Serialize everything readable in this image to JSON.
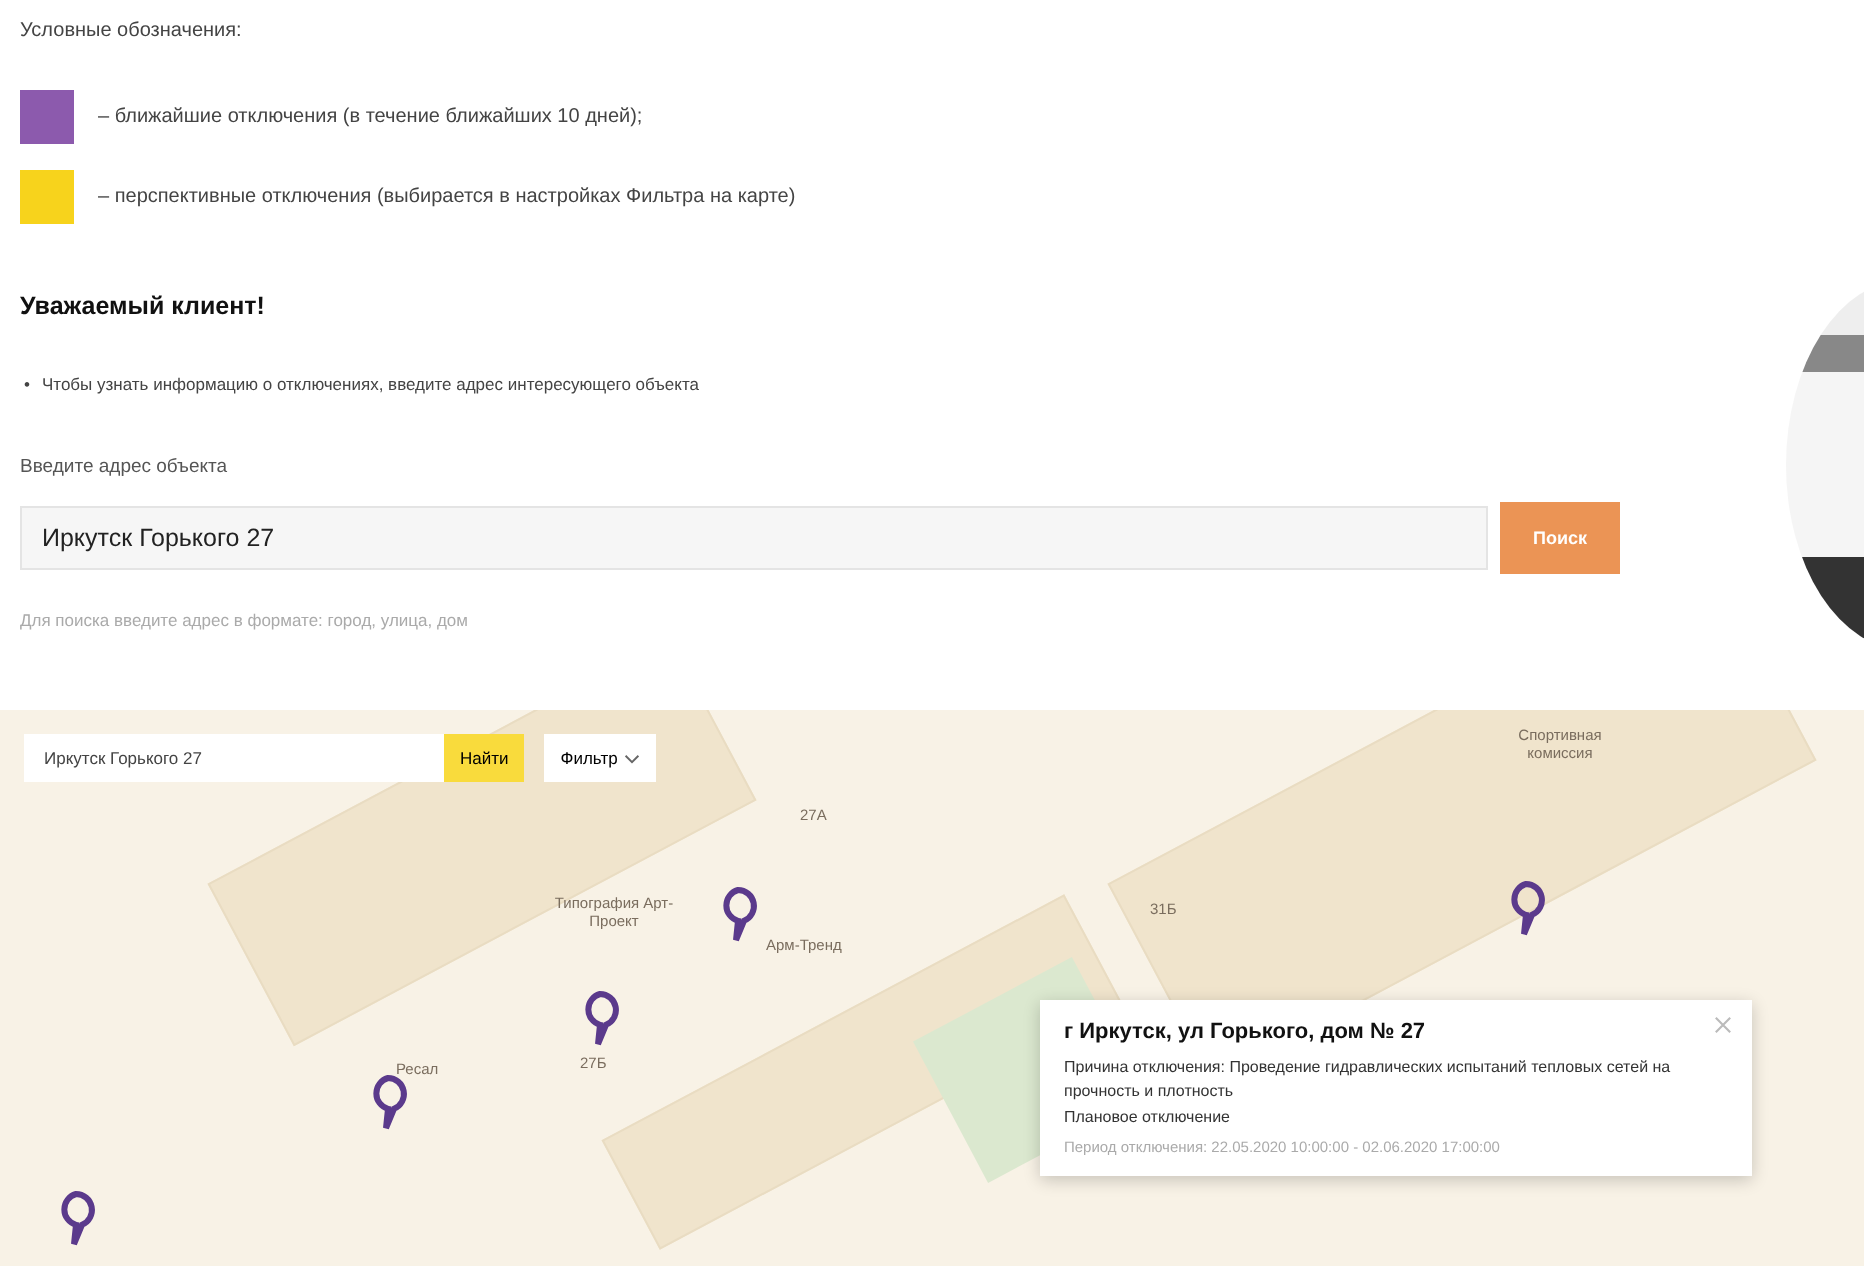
{
  "legend": {
    "title": "Условные обозначения:",
    "items": [
      {
        "color": "#8c5aad",
        "text": "– ближайшие отключения (в течение ближайших 10 дней);"
      },
      {
        "color": "#f7d31c",
        "text": "– перспективные отключения (выбирается в настройках Фильтра на карте)"
      }
    ]
  },
  "notice": {
    "heading": "Уважаемый клиент!",
    "bullets": [
      {
        "marker": "•",
        "text": "Чтобы узнать информацию о отключениях, введите адрес интересующего объекта"
      }
    ]
  },
  "address_search": {
    "label": "Введите адрес объекта",
    "value": "Иркутск Горького 27",
    "button": "Поиск",
    "hint": "Для поиска введите адрес в формате: город, улица, дом"
  },
  "map": {
    "search_value": "Иркутск Горького 27",
    "find_button": "Найти",
    "filter_button": "Фильтр",
    "labels": [
      "Типография Арт-Проект",
      "27А",
      "Арм-Тренд",
      "27Б",
      "Ресал",
      "31Б",
      "Спортивная комиссия"
    ],
    "popup": {
      "title": "г Иркутск, ул Горького, дом № 27",
      "reason": "Причина отключения: Проведение гидравлических испытаний тепловых сетей на прочность и плотность",
      "type": "Плановое отключение",
      "period": "Период отключения: 22.05.2020 10:00:00 - 02.06.2020 17:00:00"
    }
  }
}
